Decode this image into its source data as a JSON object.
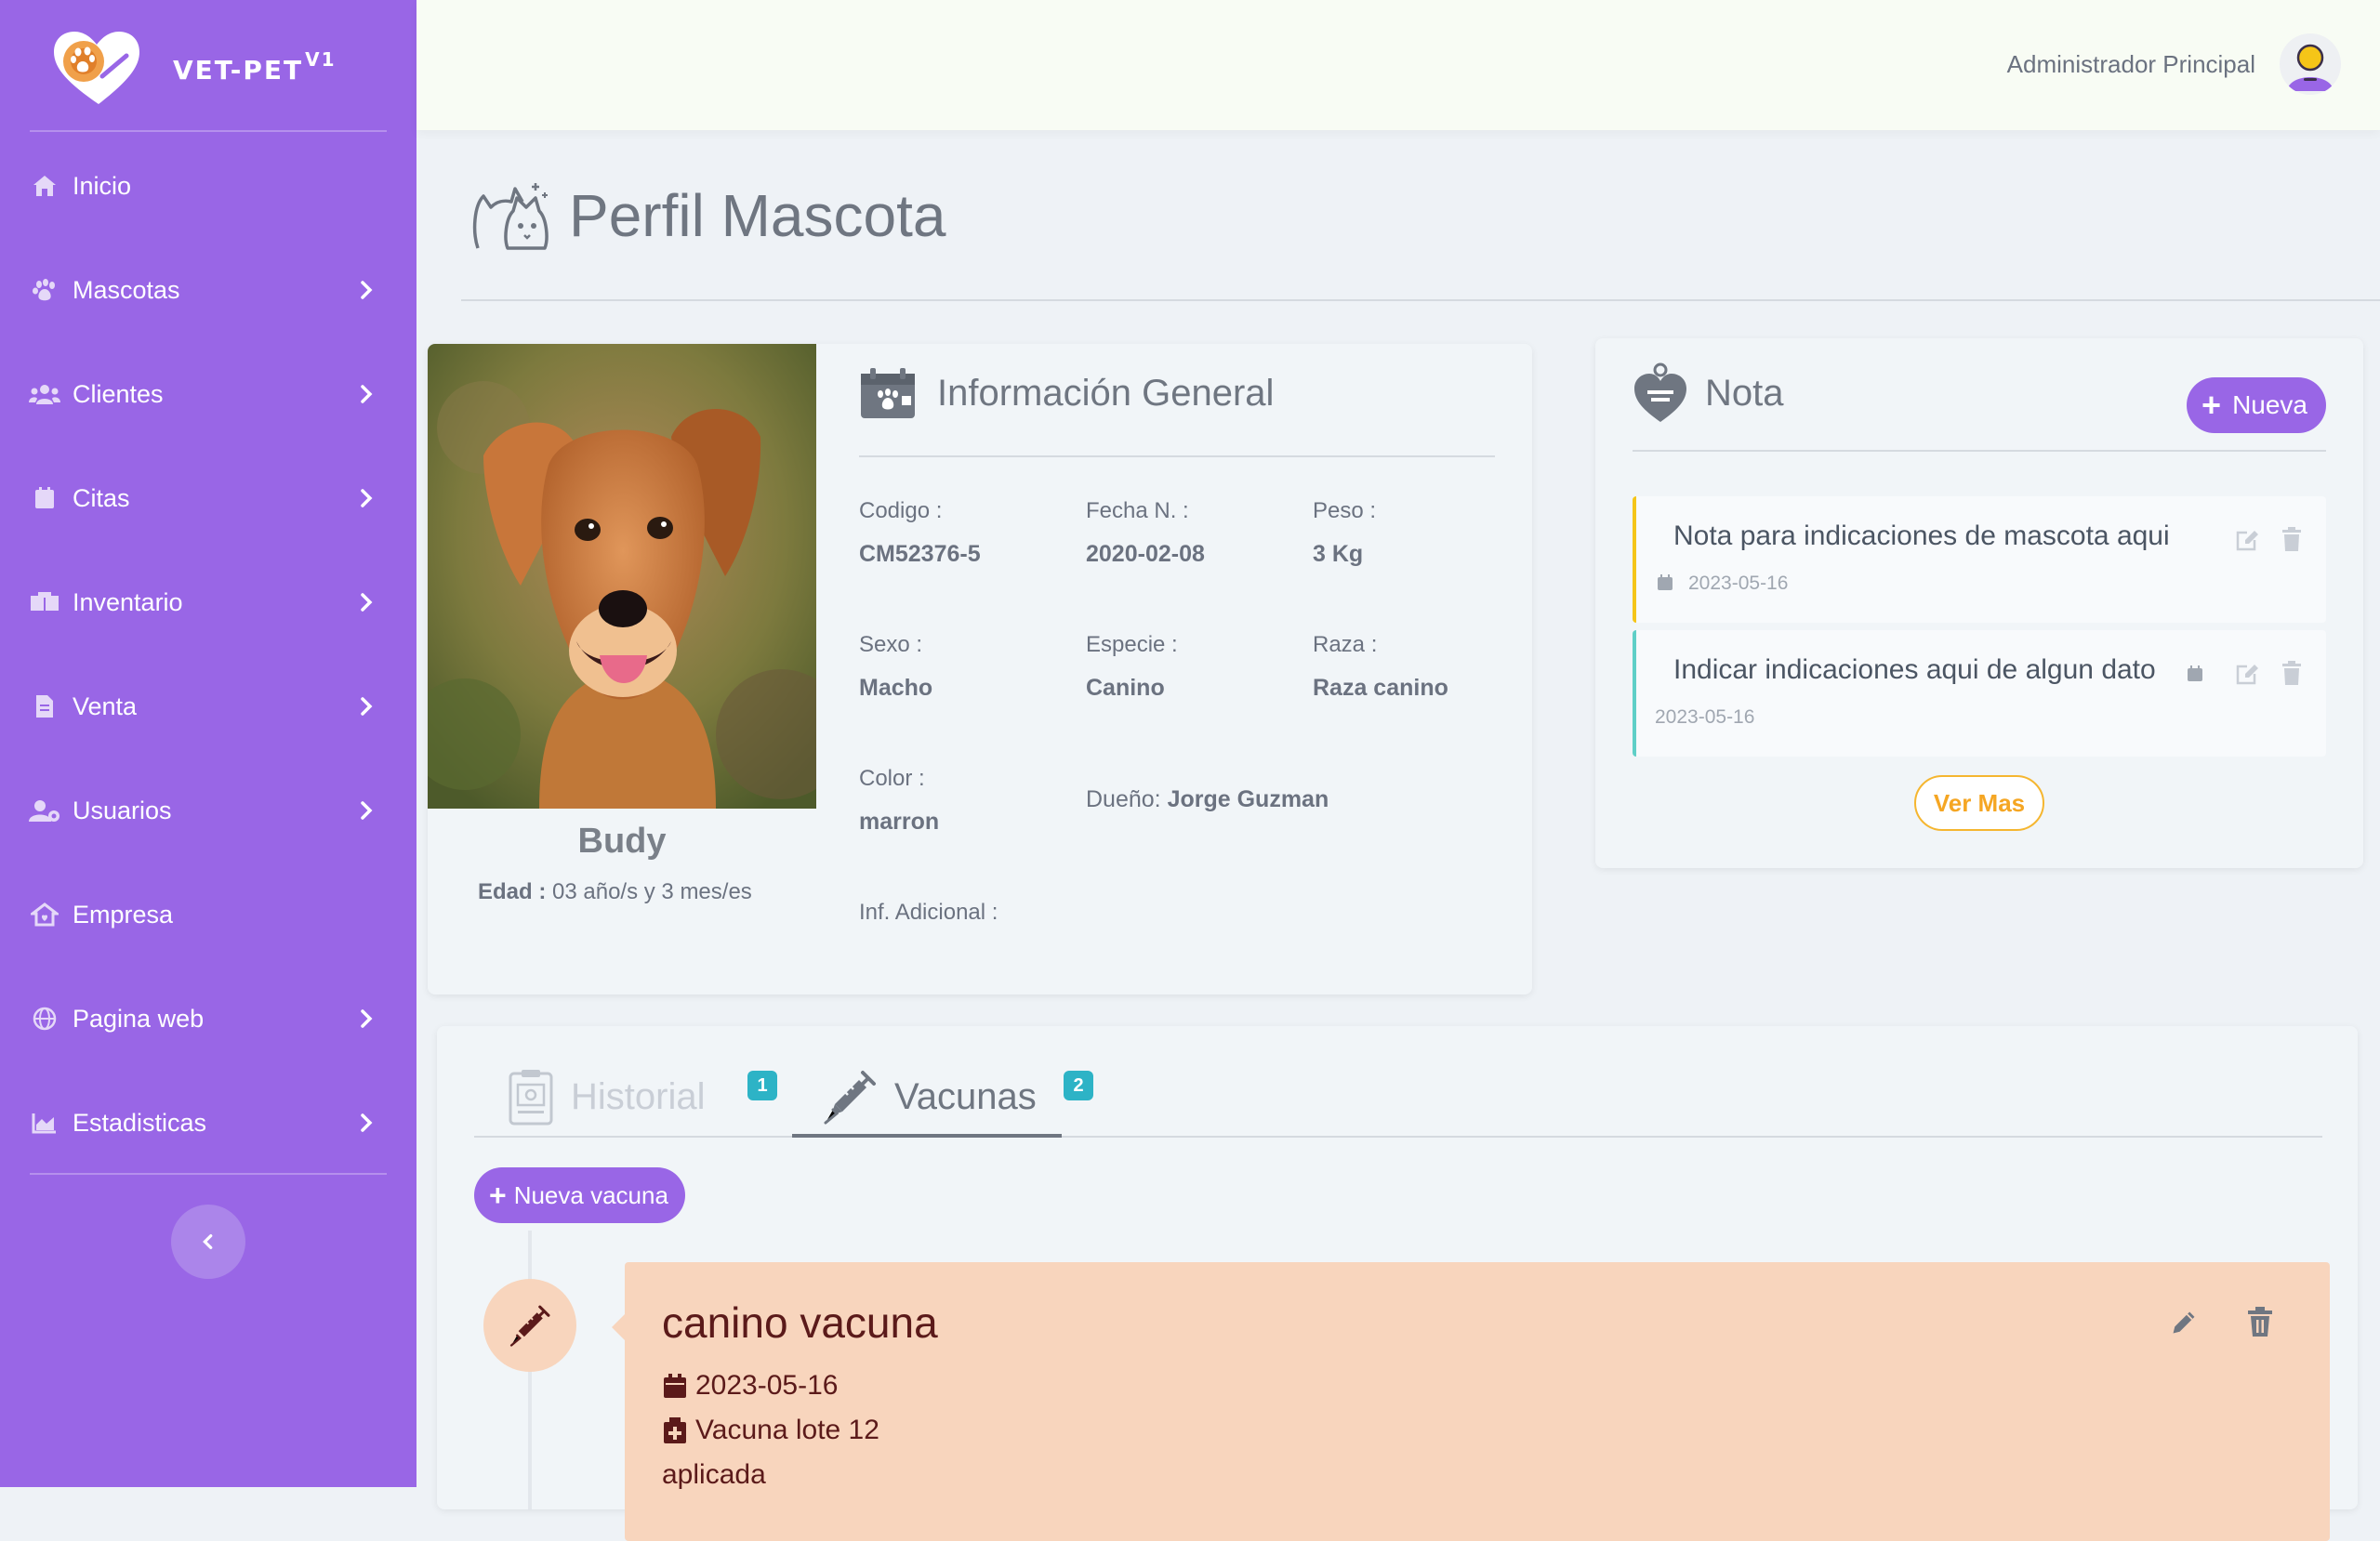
{
  "brand": {
    "name": "VET-PET",
    "version": "V1"
  },
  "sidebar": {
    "items": [
      {
        "label": "Inicio",
        "icon": "home-icon",
        "has_children": false
      },
      {
        "label": "Mascotas",
        "icon": "paw-icon",
        "has_children": true
      },
      {
        "label": "Clientes",
        "icon": "users-icon",
        "has_children": true
      },
      {
        "label": "Citas",
        "icon": "calendar-icon",
        "has_children": true
      },
      {
        "label": "Inventario",
        "icon": "boxes-icon",
        "has_children": true
      },
      {
        "label": "Venta",
        "icon": "invoice-icon",
        "has_children": true
      },
      {
        "label": "Usuarios",
        "icon": "user-gear-icon",
        "has_children": true
      },
      {
        "label": "Empresa",
        "icon": "building-icon",
        "has_children": false
      },
      {
        "label": "Pagina web",
        "icon": "globe-icon",
        "has_children": true
      },
      {
        "label": "Estadisticas",
        "icon": "chart-area-icon",
        "has_children": true
      }
    ],
    "collapse_icon": "chevron-left-icon"
  },
  "topbar": {
    "user_name": "Administrador Principal"
  },
  "page": {
    "title": "Perfil Mascota"
  },
  "pet": {
    "name": "Budy",
    "age_label": "Edad :",
    "age_value": "03 año/s y 3 mes/es",
    "info_title": "Información General",
    "fields": {
      "codigo": {
        "label": "Codigo :",
        "value": "CM52376-5"
      },
      "fecha": {
        "label": "Fecha N. :",
        "value": "2020-02-08"
      },
      "peso": {
        "label": "Peso :",
        "value": "3 Kg"
      },
      "sexo": {
        "label": "Sexo :",
        "value": "Macho"
      },
      "especie": {
        "label": "Especie :",
        "value": "Canino"
      },
      "raza": {
        "label": "Raza :",
        "value": "Raza canino"
      },
      "color": {
        "label": "Color :",
        "value": "marron"
      },
      "info_adicional": {
        "label": "Inf. Adicional :"
      }
    },
    "owner_label": "Dueño:",
    "owner_name": "Jorge Guzman"
  },
  "notes": {
    "title": "Nota",
    "new_button": "Nueva",
    "items": [
      {
        "text": "Nota para indicaciones de mascota aqui",
        "date": "2023-05-16",
        "accent": "#f5c518"
      },
      {
        "text": "Indicar indicaciones aqui de algun dato",
        "date": "2023-05-16",
        "accent": "#5fcfc7"
      }
    ],
    "more_button": "Ver Mas"
  },
  "tabs": [
    {
      "label": "Historial",
      "badge": "1",
      "active": false
    },
    {
      "label": "Vacunas",
      "badge": "2",
      "active": true
    }
  ],
  "vaccines": {
    "new_button": "Nueva vacuna",
    "items": [
      {
        "title": "canino vacuna",
        "date": "2023-05-16",
        "lot": "Vacuna lote 12",
        "status": "aplicada"
      }
    ]
  },
  "colors": {
    "primary": "#9966e6",
    "badge": "#2db3c6",
    "warning": "#f5a623",
    "vaccine_card": "#f8d5bd"
  }
}
